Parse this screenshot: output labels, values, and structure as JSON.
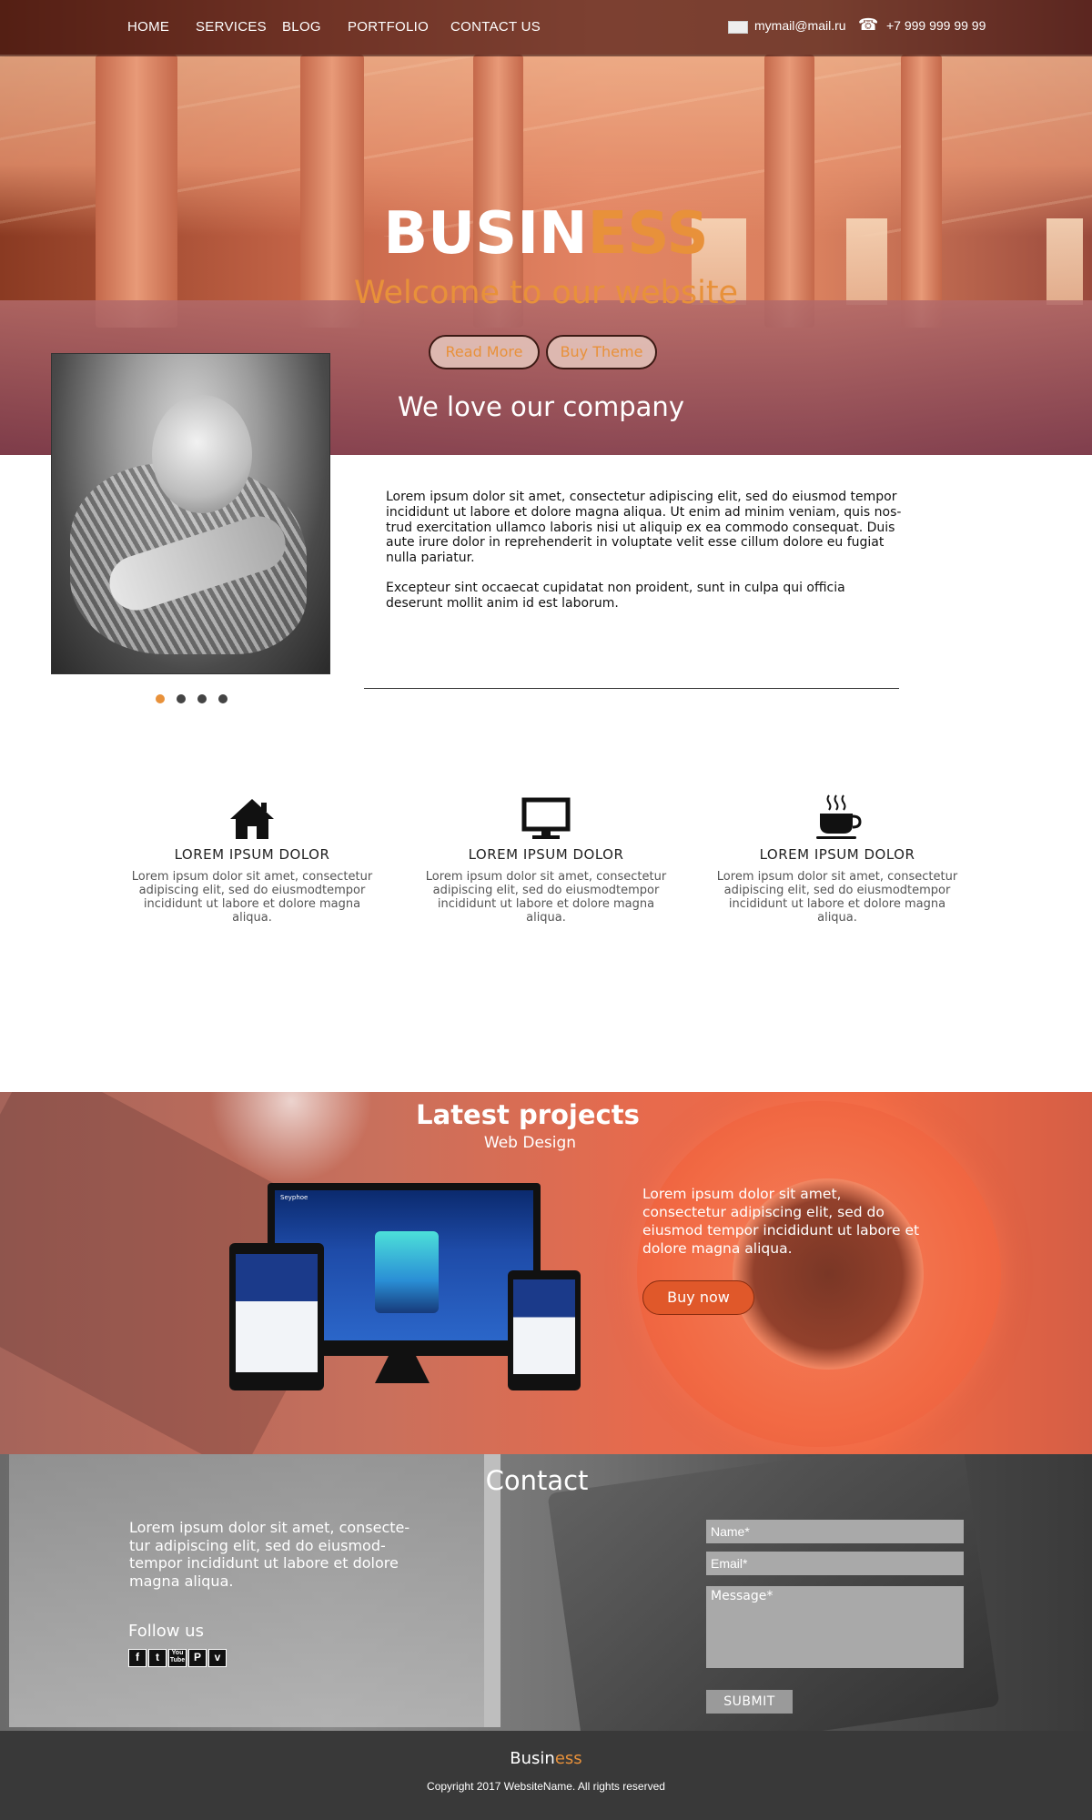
{
  "nav": {
    "items": [
      "HOME",
      "SERVICES",
      "BLOG",
      "PORTFOLIO",
      "CONTACT US"
    ],
    "email": "mymail@mail.ru",
    "phone": "+7 999 999 99 99"
  },
  "hero": {
    "brand_white": "BUSIN",
    "brand_orange": "ESS",
    "welcome": "Welcome to our website",
    "read_more": "Read More",
    "buy_theme": "Buy Theme",
    "tagline": "We love our company"
  },
  "about": {
    "paragraph1": "Lorem ipsum dolor sit amet, consectetur adipiscing elit, sed do eiusmod tempor incididunt ut labore et dolore magna aliqua. Ut enim ad minim veniam, quis nos-trud exercitation ullamco laboris nisi ut aliquip ex ea commodo consequat. Duis aute irure dolor in reprehenderit in voluptate velit esse cillum dolore eu fugiat nulla pariatur.",
    "paragraph2": "Excepteur sint occaecat cupidatat non proident, sunt in culpa qui officia deserunt mollit anim id est laborum.",
    "slider_dots": 4,
    "active_dot": 0
  },
  "features": [
    {
      "icon": "home-icon",
      "title": "LOREM IPSUM DOLOR",
      "text": "Lorem ipsum dolor sit amet, consectetur adipiscing elit, sed do eiusmodtempor incididunt ut labore et dolore magna aliqua."
    },
    {
      "icon": "monitor-icon",
      "title": "LOREM IPSUM DOLOR",
      "text": "Lorem ipsum dolor sit amet, consectetur adipiscing elit, sed do eiusmodtempor incididunt ut labore et dolore magna aliqua."
    },
    {
      "icon": "coffee-cup-icon",
      "title": "LOREM IPSUM DOLOR",
      "text": "Lorem ipsum dolor sit amet, consectetur adipiscing elit, sed do eiusmodtempor incididunt ut labore et dolore magna aliqua."
    }
  ],
  "projects": {
    "title": "Latest projects",
    "subtitle": "Web Design",
    "text": "Lorem ipsum dolor sit amet, consectetur adipiscing elit, sed do eiusmod tempor incididunt ut labore et dolore magna aliqua.",
    "buy_now": "Buy now",
    "mockup_brand": "Seyphoe"
  },
  "contact": {
    "title": "Contact",
    "text": "Lorem ipsum dolor sit amet, consecte-tur adipiscing elit, sed do eiusmod-tempor incididunt ut labore et dolore magna aliqua.",
    "follow": "Follow us",
    "socials": [
      "facebook-icon",
      "twitter-icon",
      "youtube-icon",
      "pinterest-icon",
      "vimeo-icon"
    ],
    "name_placeholder": "Name*",
    "email_placeholder": "Email*",
    "message_placeholder": "Message*",
    "submit": "SUBMIT"
  },
  "footer": {
    "brand_white": "Busin",
    "brand_orange": "ess",
    "copyright": "Copyright 2017 WebsiteName. All rights reserved"
  },
  "colors": {
    "accent": "#e8913a",
    "buy_button": "#e0582a",
    "footer_bg": "#282828"
  }
}
